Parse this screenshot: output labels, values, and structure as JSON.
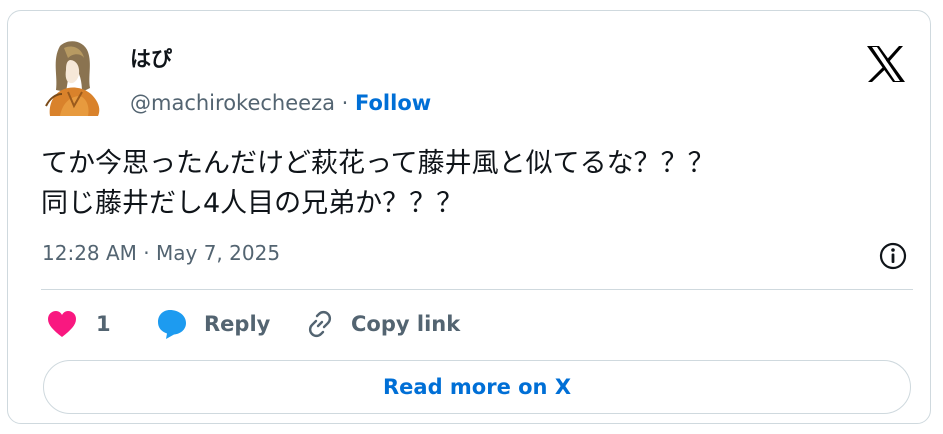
{
  "author": {
    "display_name": "はぴ",
    "handle": "@machirokecheeza",
    "separator": " · ",
    "follow_label": "Follow"
  },
  "tweet": {
    "text_lines": [
      "てか今思ったんだけど萩花って藤井風と似てるな？？？",
      "同じ藤井だし4人目の兄弟か？？？"
    ],
    "timestamp": "12:28 AM · May 7, 2025"
  },
  "actions": {
    "like_count": "1",
    "reply_label": "Reply",
    "copy_link_label": "Copy link"
  },
  "read_more_label": "Read more on X",
  "icons": {
    "brand": "x-logo-icon",
    "like": "heart-icon",
    "reply": "speech-bubble-icon",
    "copy": "link-icon",
    "info": "info-icon"
  },
  "colors": {
    "like": "#f91880",
    "reply": "#1d9bf0",
    "link_blue": "#006fd6",
    "secondary_text": "#536471",
    "border": "#cfd9de"
  }
}
